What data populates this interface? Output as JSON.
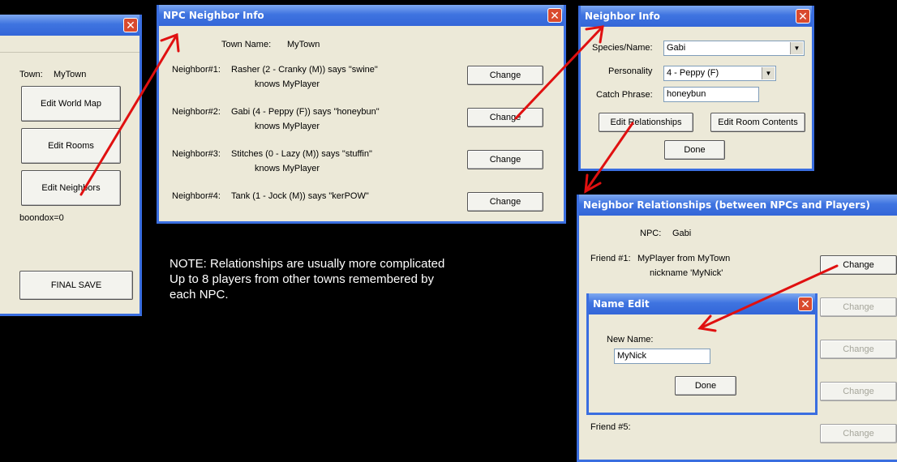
{
  "main_window": {
    "town_label": "Town:",
    "town_value": "MyTown",
    "edit_world_map": "Edit World Map",
    "edit_rooms": "Edit Rooms",
    "edit_neighbors": "Edit Neighbors",
    "boondox": "boondox=0",
    "final_save": "FINAL SAVE"
  },
  "npc_neighbor_info": {
    "title": "NPC Neighbor Info",
    "town_name_label": "Town Name:",
    "town_name_value": "MyTown",
    "neighbors": [
      {
        "label": "Neighbor#1:",
        "desc": "Rasher (2 - Cranky (M)) says \"swine\"",
        "knows": "knows MyPlayer",
        "button": "Change"
      },
      {
        "label": "Neighbor#2:",
        "desc": "Gabi (4 - Peppy (F)) says \"honeybun\"",
        "knows": "knows MyPlayer",
        "button": "Change"
      },
      {
        "label": "Neighbor#3:",
        "desc": "Stitches (0 - Lazy (M)) says \"stuffin\"",
        "knows": "knows MyPlayer",
        "button": "Change"
      },
      {
        "label": "Neighbor#4:",
        "desc": "Tank (1 - Jock (M)) says \"kerPOW\"",
        "knows": "",
        "button": "Change"
      }
    ]
  },
  "neighbor_info": {
    "title": "Neighbor Info",
    "species_label": "Species/Name:",
    "species_value": "Gabi",
    "personality_label": "Personality",
    "personality_value": "4 - Peppy (F)",
    "catch_label": "Catch Phrase:",
    "catch_value": "honeybun",
    "edit_relationships": "Edit Relationships",
    "edit_room_contents": "Edit Room Contents",
    "done": "Done"
  },
  "relationships": {
    "title": "Neighbor Relationships (between NPCs and Players)",
    "npc_label": "NPC:",
    "npc_value": "Gabi",
    "friend1_label": "Friend #1:",
    "friend1_value": "MyPlayer from MyTown",
    "friend1_nick": "nickname 'MyNick'",
    "friend5_label": "Friend #5:",
    "change": "Change"
  },
  "name_edit": {
    "title": "Name Edit",
    "new_name_label": "New Name:",
    "new_name_value": "MyNick",
    "done": "Done"
  },
  "note": {
    "line1": "NOTE: Relationships are usually more complicated",
    "line2": "Up to 8 players from other towns remembered by",
    "line3": "each NPC."
  },
  "colors": {
    "arrow": "#e01010",
    "titlebar": "#3f74e0",
    "window_bg": "#ece9d8"
  }
}
